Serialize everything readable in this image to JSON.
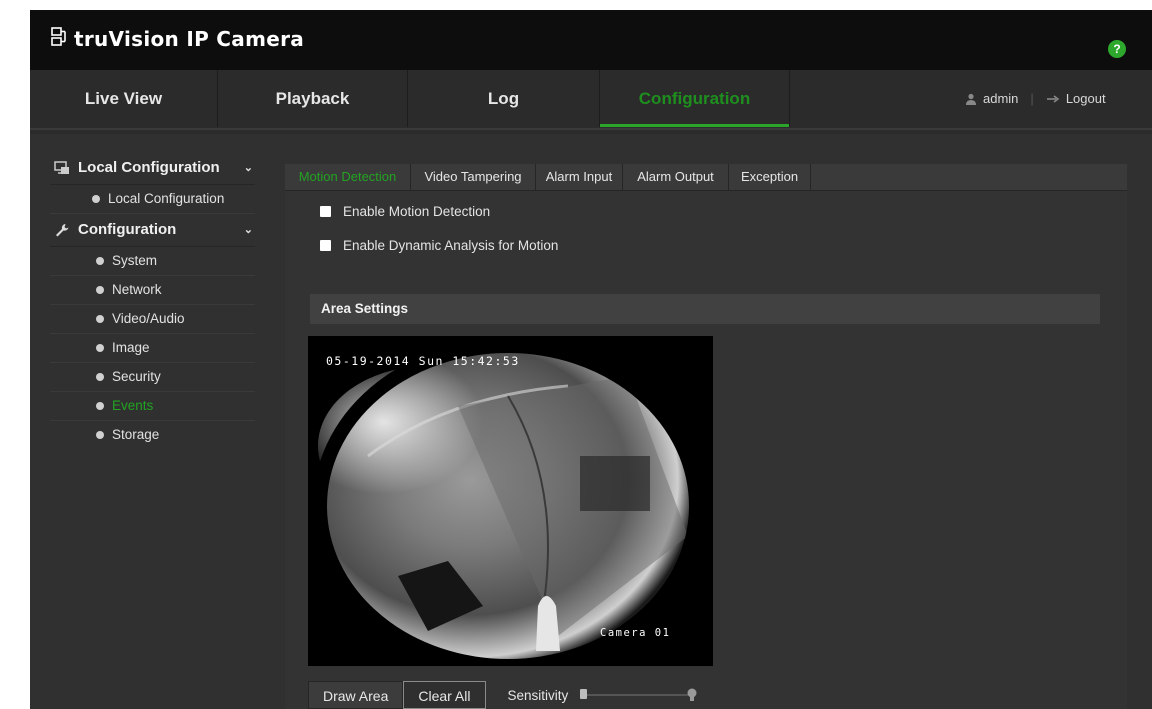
{
  "app": {
    "brand": "truVision IP Camera",
    "help_label": "?"
  },
  "nav": {
    "tabs": [
      {
        "label": "Live View",
        "active": false
      },
      {
        "label": "Playback",
        "active": false
      },
      {
        "label": "Log",
        "active": false
      },
      {
        "label": "Configuration",
        "active": true
      }
    ],
    "user": "admin",
    "logout": "Logout"
  },
  "sidebar": {
    "groups": [
      {
        "label": "Local Configuration",
        "icon": "monitor-icon",
        "items": [
          "Local Configuration"
        ]
      },
      {
        "label": "Configuration",
        "icon": "wrench-icon",
        "items": [
          "System",
          "Network",
          "Video/Audio",
          "Image",
          "Security",
          "Events",
          "Storage"
        ]
      }
    ],
    "active_item": "Events"
  },
  "subtabs": [
    {
      "label": "Motion Detection",
      "active": true
    },
    {
      "label": "Video Tampering",
      "active": false
    },
    {
      "label": "Alarm Input",
      "active": false
    },
    {
      "label": "Alarm Output",
      "active": false
    },
    {
      "label": "Exception",
      "active": false
    }
  ],
  "options": {
    "enable_motion": {
      "label": "Enable Motion Detection",
      "checked": false
    },
    "enable_dynamic": {
      "label": "Enable Dynamic Analysis for Motion",
      "checked": false
    }
  },
  "area_settings": {
    "title": "Area Settings",
    "timestamp": "05-19-2014 Sun 15:42:53",
    "camera_label": "Camera 01"
  },
  "controls": {
    "draw_area": "Draw Area",
    "clear_all": "Clear All",
    "sensitivity_label": "Sensitivity",
    "sensitivity_value": 0
  },
  "colors": {
    "accent": "#22a322",
    "background": "#2b2b2b",
    "topbar": "#0d0d0d"
  }
}
